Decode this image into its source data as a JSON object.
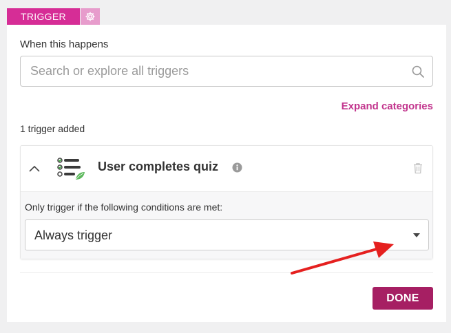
{
  "tabs": {
    "trigger_label": "TRIGGER",
    "gear_icon": "gear-icon"
  },
  "when_label": "When this happens",
  "search": {
    "placeholder": "Search or explore all triggers",
    "value": "",
    "icon": "search-icon"
  },
  "expand_link": "Expand categories",
  "triggers_added": "1 trigger added",
  "trigger_card": {
    "title": "User completes quiz",
    "icon": "quiz-checklist-icon",
    "conditions_label": "Only trigger if the following conditions are met:",
    "select_value": "Always trigger"
  },
  "done_label": "DONE",
  "colors": {
    "accent": "#d62d96",
    "accent_light": "#e79ccc",
    "link": "#c2358d",
    "done": "#a61f63",
    "annotation_arrow": "#e5201f"
  }
}
